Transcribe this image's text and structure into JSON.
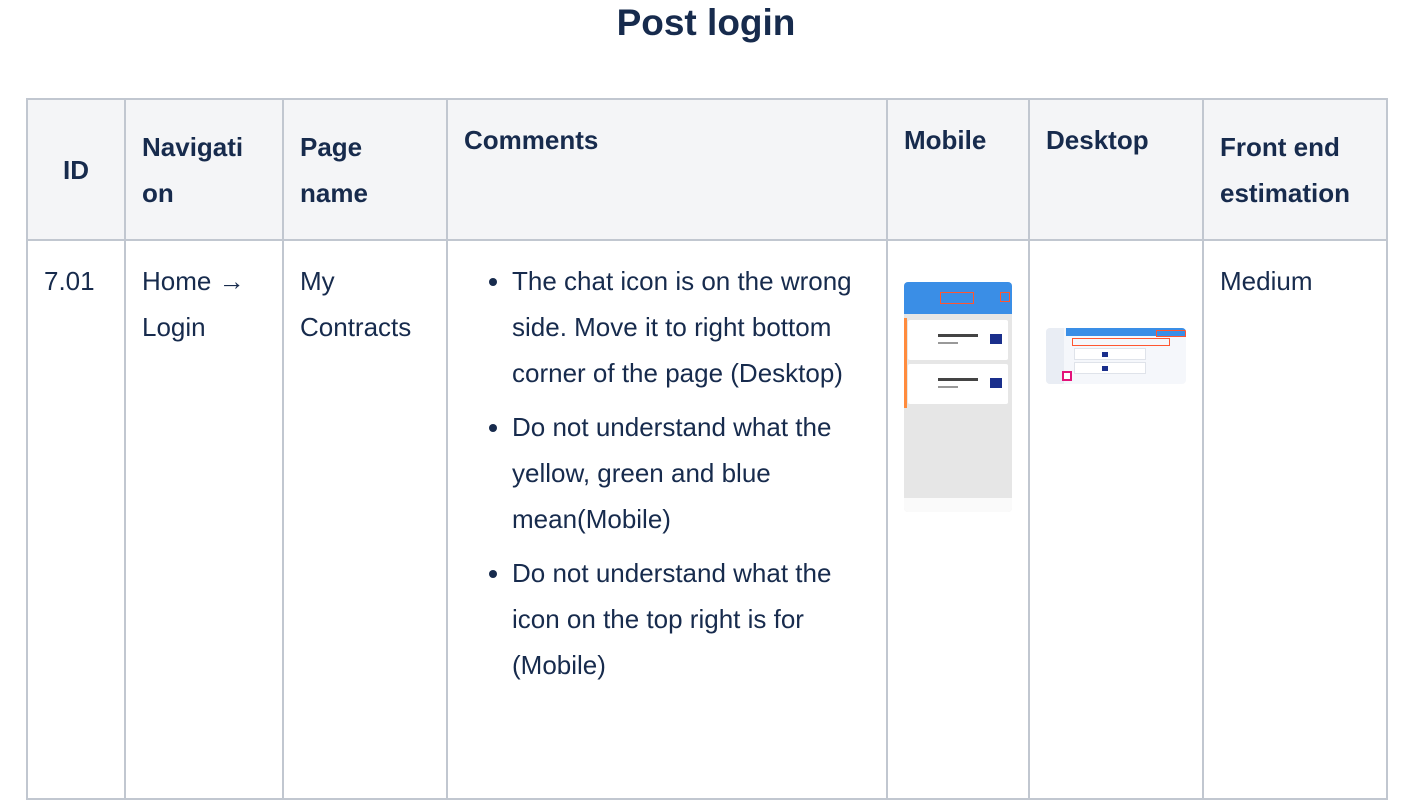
{
  "title": "Post login",
  "table": {
    "headers": [
      "ID",
      "Navigati on",
      "Page name",
      "Comments",
      "Mobile",
      "Desktop",
      "Front end estimation"
    ],
    "rows": [
      {
        "id": "7.01",
        "navigation": "Home → Login",
        "page_name": "My Contracts",
        "comments": [
          "The chat icon is on the wrong side. Move it to right bottom corner of the page (Desktop)",
          "Do not understand what the yellow, green and blue mean(Mobile)",
          "Do not understand what the icon on the top right is for (Mobile)"
        ],
        "mobile": "mobile-screenshot-thumbnail",
        "desktop": "desktop-screenshot-thumbnail",
        "estimation": "Medium"
      }
    ]
  },
  "colors": {
    "text": "#172b4d",
    "header_bg": "#f4f5f7",
    "border": "#c1c7d0"
  }
}
